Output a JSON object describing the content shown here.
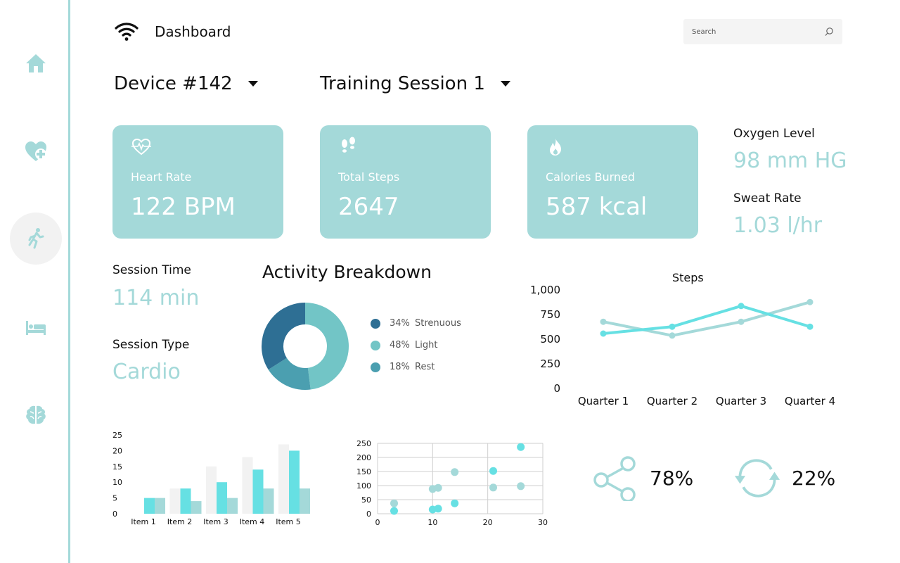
{
  "header": {
    "title": "Dashboard",
    "search_placeholder": "Search"
  },
  "sidebar": {
    "items": [
      {
        "name": "home",
        "icon": "home-icon"
      },
      {
        "name": "health",
        "icon": "heart-plus-icon"
      },
      {
        "name": "activity",
        "icon": "running-icon",
        "active": true
      },
      {
        "name": "sleep",
        "icon": "bed-icon"
      },
      {
        "name": "mind",
        "icon": "brain-icon"
      }
    ]
  },
  "selectors": {
    "device": "Device #142",
    "session": "Training Session 1"
  },
  "cards": {
    "heart_rate": {
      "label": "Heart Rate",
      "value": "122 BPM",
      "icon": "heart-pulse-icon"
    },
    "total_steps": {
      "label": "Total Steps",
      "value": "2647",
      "icon": "footprints-icon"
    },
    "calories": {
      "label": "Calories Burned",
      "value": "587 kcal",
      "icon": "flame-icon"
    }
  },
  "stats": {
    "oxygen": {
      "label": "Oxygen Level",
      "value": "98 mm HG"
    },
    "sweat": {
      "label": "Sweat Rate",
      "value": "1.03 l/hr"
    },
    "session_time": {
      "label": "Session Time",
      "value": "114 min"
    },
    "session_type": {
      "label": "Session Type",
      "value": "Cardio"
    }
  },
  "activity": {
    "title": "Activity Breakdown",
    "legend": [
      {
        "pct": "34%",
        "label": "Strenuous",
        "color": "#2e6f94"
      },
      {
        "pct": "48%",
        "label": "Light",
        "color": "#72c5c6"
      },
      {
        "pct": "18%",
        "label": "Rest",
        "color": "#4b9fb0"
      }
    ]
  },
  "steps_chart_title": "Steps",
  "icon_stats": {
    "share": "78%",
    "sync": "22%"
  },
  "colors": {
    "accent": "#a4d9d9",
    "bright": "#66e0e3",
    "dark": "#2e6f94"
  },
  "chart_data": [
    {
      "type": "pie",
      "title": "Activity Breakdown",
      "categories": [
        "Strenuous",
        "Light",
        "Rest"
      ],
      "values": [
        34,
        48,
        18
      ],
      "colors": [
        "#2e6f94",
        "#72c5c6",
        "#4b9fb0"
      ],
      "legend": "right"
    },
    {
      "type": "line",
      "title": "Steps",
      "categories": [
        "Quarter 1",
        "Quarter 2",
        "Quarter 3",
        "Quarter 4"
      ],
      "series": [
        {
          "values": [
            670,
            530,
            670,
            870
          ],
          "color": "#a4d9d9"
        },
        {
          "values": [
            550,
            620,
            830,
            620
          ],
          "color": "#66e0e3"
        }
      ],
      "ylim": [
        0,
        1000
      ],
      "yticks": [
        "0",
        "250",
        "500",
        "750",
        "1,000"
      ],
      "grid": false
    },
    {
      "type": "bar",
      "categories": [
        "Item 1",
        "Item 2",
        "Item 3",
        "Item 4",
        "Item 5"
      ],
      "series": [
        {
          "values": [
            0,
            8,
            15,
            18,
            22
          ],
          "color": "#f2f2f2"
        },
        {
          "values": [
            5,
            8,
            10,
            14,
            20
          ],
          "color": "#66e0e3"
        },
        {
          "values": [
            5,
            4,
            5,
            8,
            8
          ],
          "color": "#a4d9d9"
        }
      ],
      "ylim": [
        0,
        25
      ],
      "yticks": [
        "0",
        "5",
        "10",
        "15",
        "20",
        "25"
      ]
    },
    {
      "type": "scatter",
      "series": [
        {
          "color": "#66e0e3",
          "points": [
            [
              3,
              10
            ],
            [
              10,
              15
            ],
            [
              11,
              18
            ],
            [
              14,
              37
            ],
            [
              21,
              152
            ],
            [
              26,
              237
            ]
          ]
        },
        {
          "color": "#a4d9d9",
          "points": [
            [
              3,
              37
            ],
            [
              10,
              88
            ],
            [
              11,
              92
            ],
            [
              14,
              148
            ],
            [
              21,
              93
            ],
            [
              26,
              98
            ]
          ]
        }
      ],
      "xlim": [
        0,
        30
      ],
      "ylim": [
        0,
        250
      ],
      "xticks": [
        "0",
        "10",
        "20",
        "30"
      ],
      "yticks": [
        "0",
        "50",
        "100",
        "150",
        "200",
        "250"
      ],
      "grid": true
    }
  ]
}
